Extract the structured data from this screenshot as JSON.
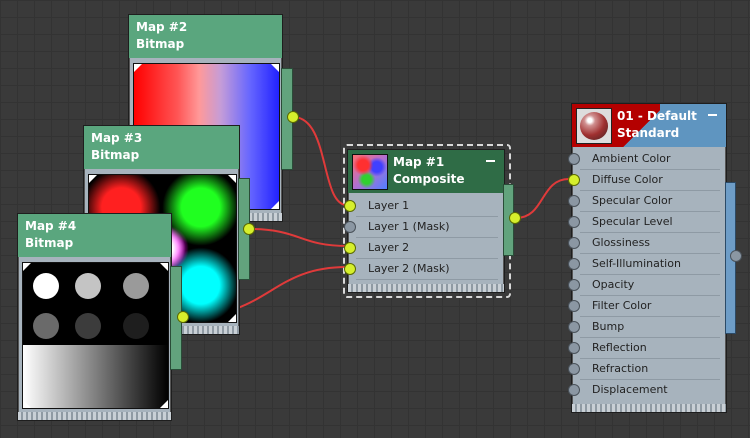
{
  "nodes": {
    "map2": {
      "name": "Map #2",
      "type": "Bitmap"
    },
    "map3": {
      "name": "Map #3",
      "type": "Bitmap"
    },
    "map4": {
      "name": "Map #4",
      "type": "Bitmap"
    },
    "map1": {
      "name": "Map #1",
      "type": "Composite",
      "slots": [
        {
          "label": "Layer 1",
          "connected": true
        },
        {
          "label": "Layer 1 (Mask)",
          "connected": false
        },
        {
          "label": "Layer 2",
          "connected": true
        },
        {
          "label": "Layer 2 (Mask)",
          "connected": true
        }
      ]
    },
    "material": {
      "name": "01 - Default",
      "type": "Standard",
      "slots": [
        {
          "label": "Ambient Color",
          "connected": false
        },
        {
          "label": "Diffuse Color",
          "connected": true
        },
        {
          "label": "Specular Color",
          "connected": false
        },
        {
          "label": "Specular Level",
          "connected": false
        },
        {
          "label": "Glossiness",
          "connected": false
        },
        {
          "label": "Self-Illumination",
          "connected": false
        },
        {
          "label": "Opacity",
          "connected": false
        },
        {
          "label": "Filter Color",
          "connected": false
        },
        {
          "label": "Bump",
          "connected": false
        },
        {
          "label": "Reflection",
          "connected": false
        },
        {
          "label": "Refraction",
          "connected": false
        },
        {
          "label": "Displacement",
          "connected": false
        }
      ]
    }
  },
  "colors": {
    "header_green": "#5aa67e",
    "header_selected": "#2f6c46",
    "header_material": "#5f95c0",
    "socket_connected": "#d6ef2c",
    "socket_empty": "#8b97a3",
    "wire": "#e03a3a"
  },
  "icons": {
    "composite_preview": "composite-map-thumbnail-icon",
    "material_preview": "material-sphere-icon"
  }
}
